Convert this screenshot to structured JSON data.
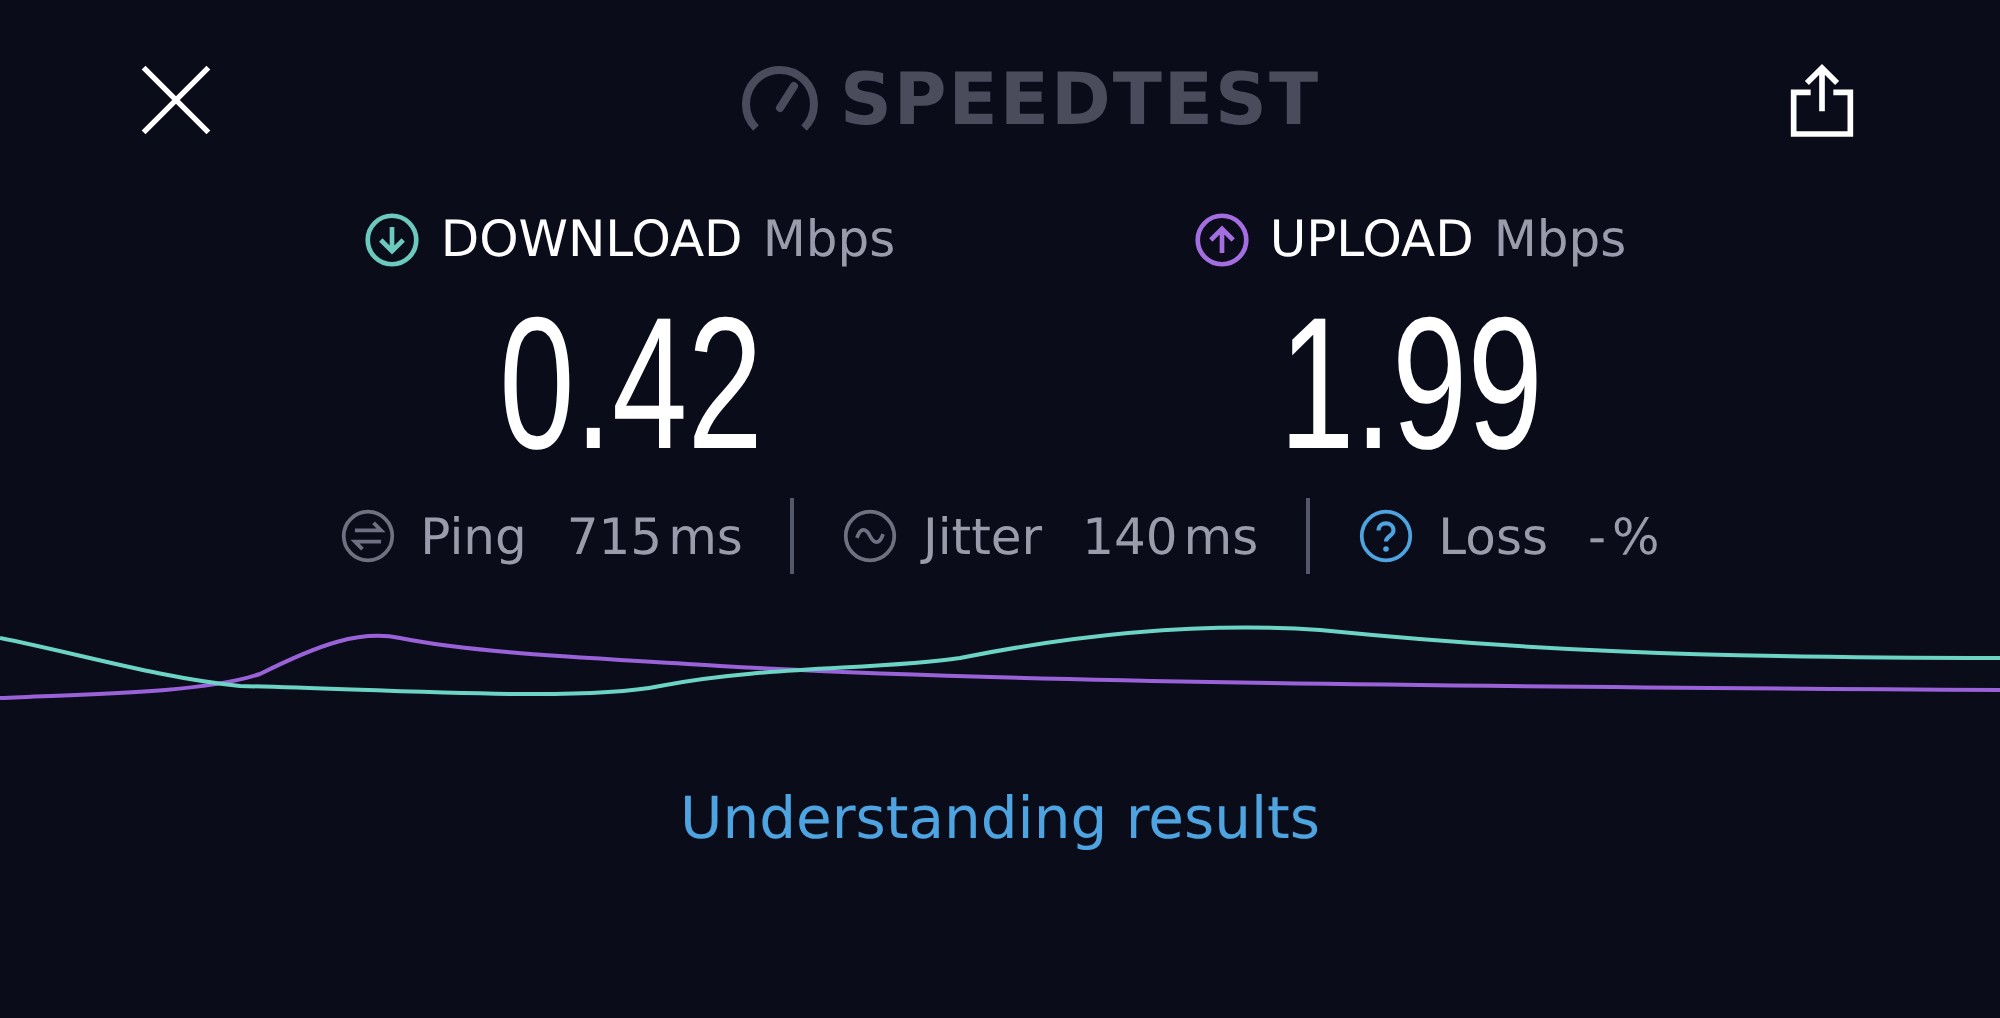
{
  "header": {
    "logo": "SPEEDTEST"
  },
  "results": [
    {
      "kind": "download",
      "label": "DOWNLOAD",
      "unit": "Mbps",
      "value": "0.42"
    },
    {
      "kind": "upload",
      "label": "UPLOAD",
      "unit": "Mbps",
      "value": "1.99"
    }
  ],
  "stats": [
    {
      "kind": "ping",
      "label": "Ping",
      "value": "715",
      "unit": "ms"
    },
    {
      "kind": "jitter",
      "label": "Jitter",
      "value": "140",
      "unit": "ms"
    },
    {
      "kind": "loss",
      "label": "Loss",
      "value": "-",
      "unit": "%"
    }
  ],
  "link": "Understanding results"
}
